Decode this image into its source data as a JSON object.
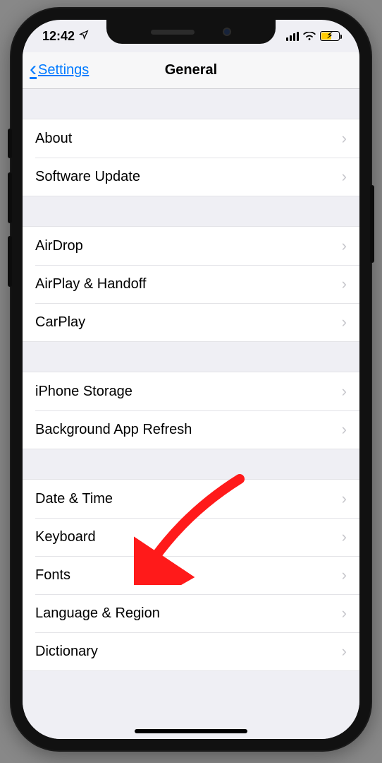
{
  "status": {
    "time": "12:42"
  },
  "navbar": {
    "back": "Settings",
    "title": "General"
  },
  "groups": [
    {
      "items": [
        {
          "label": "About"
        },
        {
          "label": "Software Update"
        }
      ]
    },
    {
      "items": [
        {
          "label": "AirDrop"
        },
        {
          "label": "AirPlay & Handoff"
        },
        {
          "label": "CarPlay"
        }
      ]
    },
    {
      "items": [
        {
          "label": "iPhone Storage"
        },
        {
          "label": "Background App Refresh"
        }
      ]
    },
    {
      "items": [
        {
          "label": "Date & Time"
        },
        {
          "label": "Keyboard"
        },
        {
          "label": "Fonts"
        },
        {
          "label": "Language & Region"
        },
        {
          "label": "Dictionary"
        }
      ]
    }
  ],
  "annotation": {
    "target": "Keyboard"
  }
}
